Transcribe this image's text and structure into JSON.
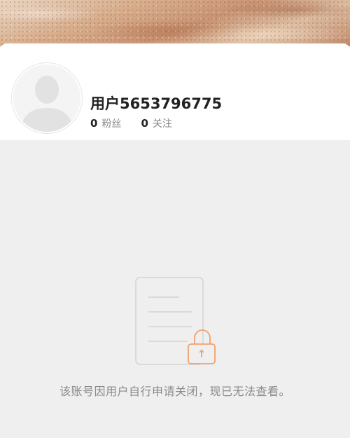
{
  "profile": {
    "username": "用户5653796775",
    "avatar_icon": "default-user-silhouette",
    "stats": [
      {
        "count": "0",
        "label": "粉丝"
      },
      {
        "count": "0",
        "label": "关注"
      }
    ]
  },
  "empty_state": {
    "icon": "document-lock-icon",
    "message": "该账号因用户自行申请关闭，现已无法查看。",
    "accent_color": "#f3a06a"
  }
}
